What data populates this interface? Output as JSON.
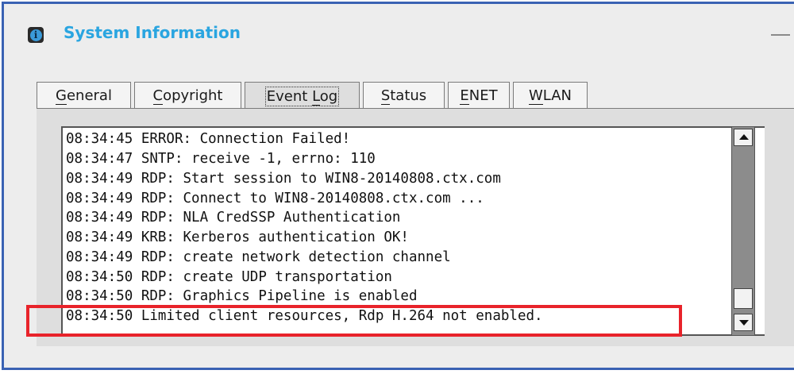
{
  "window": {
    "title": "System Information",
    "info_icon": "info-icon",
    "minimize_icon": "minimize-icon"
  },
  "tabs": [
    {
      "label": "General",
      "mnemonic": "G",
      "rest": "eneral",
      "active": false
    },
    {
      "label": "Copyright",
      "mnemonic": "C",
      "rest": "opyright",
      "active": false
    },
    {
      "label": "Event Log",
      "prefix": "Event ",
      "mnemonic": "L",
      "rest": "og",
      "active": true
    },
    {
      "label": "Status",
      "mnemonic": "S",
      "rest": "tatus",
      "active": false
    },
    {
      "label": "ENET",
      "mnemonic": "E",
      "rest": "NET",
      "active": false
    },
    {
      "label": "WLAN",
      "mnemonic": "W",
      "rest": "LAN",
      "active": false
    }
  ],
  "event_log": {
    "lines": [
      "08:34:45 ERROR: Connection Failed!",
      "08:34:47 SNTP: receive -1, errno: 110",
      "08:34:49 RDP: Start session to WIN8-20140808.ctx.com",
      "08:34:49 RDP: Connect to WIN8-20140808.ctx.com ...",
      "08:34:49 RDP: NLA CredSSP Authentication",
      "08:34:49 KRB: Kerberos authentication OK!",
      "08:34:49 RDP: create network detection channel",
      "08:34:50 RDP: create UDP transportation",
      "08:34:50 RDP: Graphics Pipeline is enabled",
      "08:34:50 Limited client resources, Rdp H.264 not enabled."
    ],
    "highlighted_line_index": 9
  },
  "colors": {
    "window_border": "#3a62b3",
    "title": "#2aa5e0",
    "highlight": "#e8232a",
    "background": "#ededed"
  }
}
